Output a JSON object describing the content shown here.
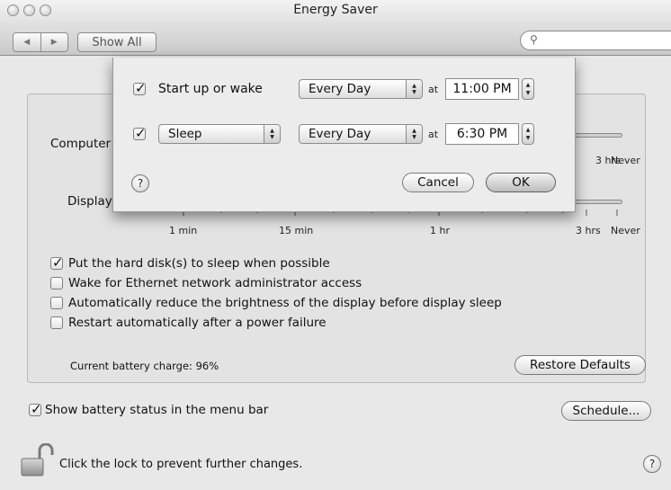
{
  "window": {
    "title": "Energy Saver"
  },
  "toolbar": {
    "back_icon": "left-triangle-icon",
    "forward_icon": "right-triangle-icon",
    "show_all_label": "Show All",
    "search_placeholder": ""
  },
  "sliders": {
    "computer": {
      "label": "Computer"
    },
    "display": {
      "label": "Display"
    },
    "tick_labels": [
      "1 min",
      "15 min",
      "1 hr",
      "3 hrs",
      "Never"
    ]
  },
  "options": [
    {
      "label": "Put the hard disk(s) to sleep when possible",
      "checked": true
    },
    {
      "label": "Wake for Ethernet network administrator access",
      "checked": false
    },
    {
      "label": "Automatically reduce the brightness of the display before display sleep",
      "checked": false
    },
    {
      "label": "Restart automatically after a power failure",
      "checked": false
    }
  ],
  "battery": {
    "charge_text": "Current battery charge: 96%"
  },
  "buttons": {
    "restore_defaults": "Restore Defaults",
    "schedule": "Schedule..."
  },
  "show_battery": {
    "label": "Show battery status in the menu bar",
    "checked": true
  },
  "lock": {
    "text": "Click the lock to prevent further changes."
  },
  "schedule_sheet": {
    "row1": {
      "checked": true,
      "action": "Start up or wake",
      "frequency": "Every Day",
      "at": "at",
      "time": "11:00 PM"
    },
    "row2": {
      "checked": true,
      "action": "Sleep",
      "frequency": "Every Day",
      "at": "at",
      "time": "6:30 PM"
    },
    "cancel": "Cancel",
    "ok": "OK",
    "help": "?"
  },
  "help_glyph": "?"
}
